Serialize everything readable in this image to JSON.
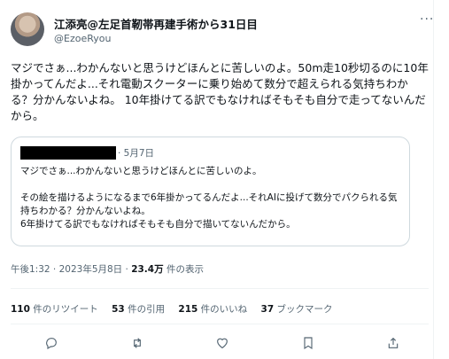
{
  "author": {
    "display_name": "江添亮@左足首靭帯再建手術から31日目",
    "handle": "@EzoeRyou"
  },
  "tweet": {
    "text": "マジでさぁ...わかんないと思うけどほんとに苦しいのよ。50m走10秒切るのに10年掛かってんだよ...それ電動スクーターに乗り始めて数分で超えられる気持ちわかる？分かんないよね。 10年掛けてる訳でもなければそもそも自分で走ってないんだから。"
  },
  "quote": {
    "date": "· 5月7日",
    "text": "マジでさぁ...わかんないと思うけどほんとに苦しいのよ。\n\nその絵を描けるようになるまで6年掛かってるんだよ...それAIに投げて数分でパクられる気持ちわかる？分かんないよね。\n6年掛けてる訳でもなければそもそも自分で描いてないんだから。"
  },
  "meta": {
    "time_date": "午後1:32 · 2023年5月8日 · ",
    "views_count": "23.4万",
    "views_label": " 件の表示"
  },
  "stats": {
    "retweets_count": "110",
    "retweets_label": " 件のリツイート",
    "quotes_count": "53",
    "quotes_label": " 件の引用",
    "likes_count": "215",
    "likes_label": " 件のいいね",
    "bookmarks_count": "37",
    "bookmarks_label": " ブックマーク"
  },
  "icons": [
    "reply-icon",
    "retweet-icon",
    "like-icon",
    "bookmark-icon",
    "share-icon"
  ]
}
